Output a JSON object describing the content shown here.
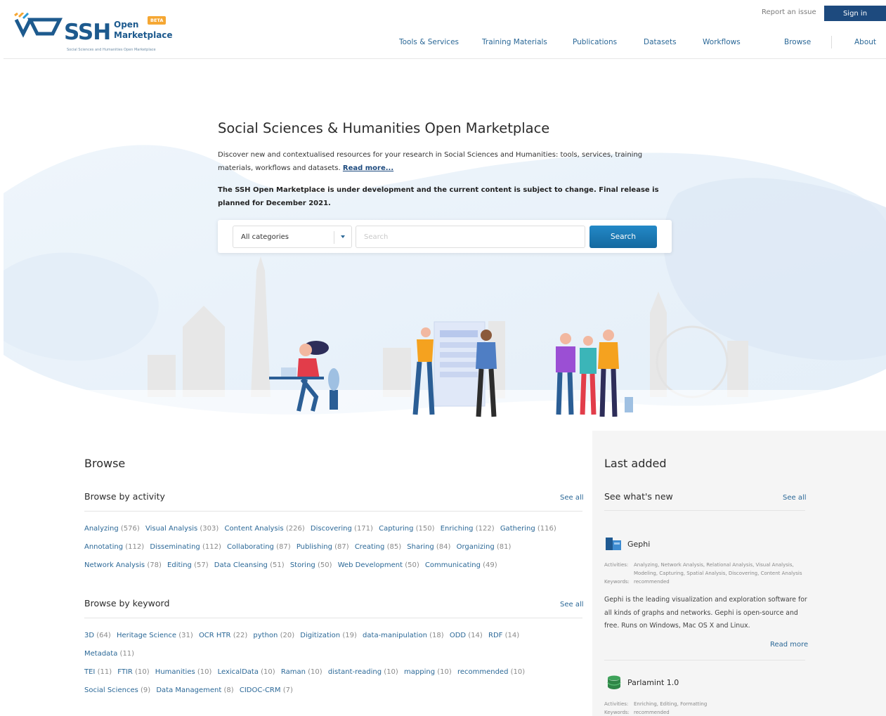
{
  "header": {
    "logo": {
      "brand": "SSH",
      "line1": "Open",
      "line2": "Marketplace",
      "badge": "BETA",
      "tagline": "Social Sciences and Humanities Open Marketplace"
    },
    "report_issue": "Report an issue",
    "sign_in": "Sign in",
    "nav": [
      "Tools & Services",
      "Training Materials",
      "Publications",
      "Datasets",
      "Workflows",
      "Browse",
      "About"
    ]
  },
  "hero": {
    "title": "Social Sciences & Humanities Open Marketplace",
    "description": "Discover new and contextualised resources for your research in Social Sciences and Humanities: tools, services, training materials, workflows and datasets.",
    "read_more": "Read more...",
    "notice": "The SSH Open Marketplace is under development and the current content is subject to change. Final release is planned for December 2021.",
    "category_selected": "All categories",
    "search_placeholder": "Search",
    "search_button": "Search"
  },
  "browse": {
    "title": "Browse",
    "activity": {
      "title": "Browse by activity",
      "see_all": "See all",
      "rows": [
        [
          {
            "label": "Analyzing",
            "count": "(576)"
          },
          {
            "label": "Visual Analysis",
            "count": "(303)"
          },
          {
            "label": "Content Analysis",
            "count": "(226)"
          },
          {
            "label": "Discovering",
            "count": "(171)"
          },
          {
            "label": "Capturing",
            "count": "(150)"
          },
          {
            "label": "Enriching",
            "count": "(122)"
          },
          {
            "label": "Gathering",
            "count": "(116)"
          }
        ],
        [
          {
            "label": "Annotating",
            "count": "(112)"
          },
          {
            "label": "Disseminating",
            "count": "(112)"
          },
          {
            "label": "Collaborating",
            "count": "(87)"
          },
          {
            "label": "Publishing",
            "count": "(87)"
          },
          {
            "label": "Creating",
            "count": "(85)"
          },
          {
            "label": "Sharing",
            "count": "(84)"
          },
          {
            "label": "Organizing",
            "count": "(81)"
          }
        ],
        [
          {
            "label": "Network Analysis",
            "count": "(78)"
          },
          {
            "label": "Editing",
            "count": "(57)"
          },
          {
            "label": "Data Cleansing",
            "count": "(51)"
          },
          {
            "label": "Storing",
            "count": "(50)"
          },
          {
            "label": "Web Development",
            "count": "(50)"
          },
          {
            "label": "Communicating",
            "count": "(49)"
          }
        ]
      ]
    },
    "keyword": {
      "title": "Browse by keyword",
      "see_all": "See all",
      "rows": [
        [
          {
            "label": "3D",
            "count": "(64)"
          },
          {
            "label": "Heritage Science",
            "count": "(31)"
          },
          {
            "label": "OCR HTR",
            "count": "(22)"
          },
          {
            "label": "python",
            "count": "(20)"
          },
          {
            "label": "Digitization",
            "count": "(19)"
          },
          {
            "label": "data-manipulation",
            "count": "(18)"
          },
          {
            "label": "ODD",
            "count": "(14)"
          },
          {
            "label": "RDF",
            "count": "(14)"
          },
          {
            "label": "Metadata",
            "count": "(11)"
          }
        ],
        [
          {
            "label": "TEI",
            "count": "(11)"
          },
          {
            "label": "FTIR",
            "count": "(10)"
          },
          {
            "label": "Humanities",
            "count": "(10)"
          },
          {
            "label": "LexicalData",
            "count": "(10)"
          },
          {
            "label": "Raman",
            "count": "(10)"
          },
          {
            "label": "distant-reading",
            "count": "(10)"
          },
          {
            "label": "mapping",
            "count": "(10)"
          },
          {
            "label": "recommended",
            "count": "(10)"
          }
        ],
        [
          {
            "label": "Social Sciences",
            "count": "(9)"
          },
          {
            "label": "Data Management",
            "count": "(8)"
          },
          {
            "label": "CIDOC-CRM",
            "count": "(7)"
          }
        ]
      ]
    }
  },
  "last_added": {
    "title": "Last added",
    "subtitle": "See what's new",
    "see_all": "See all",
    "items": [
      {
        "name": "Gephi",
        "icon": "tool-icon",
        "activities_label": "Activities:",
        "activities": "Analyzing, Network Analysis, Relational Analysis, Visual Analysis, Modeling, Capturing, Spatial Analysis, Discovering, Content Analysis",
        "keywords_label": "Keywords:",
        "keywords": "recommended",
        "description": "Gephi is the leading visualization and exploration software for all kinds of graphs and networks. Gephi is open-source and free. Runs on Windows, Mac OS X and Linux.",
        "read_more": "Read more"
      },
      {
        "name": "Parlamint 1.0",
        "icon": "dataset-icon",
        "activities_label": "Activities:",
        "activities": "Enriching, Editing, Formatting",
        "keywords_label": "Keywords:",
        "keywords": "recommended"
      }
    ]
  },
  "colors": {
    "primary": "#1d4a7e",
    "link": "#2b6897",
    "accent_orange": "#f5a733",
    "search_button": "#1a7cba",
    "panel_bg": "#f5f5f5"
  }
}
